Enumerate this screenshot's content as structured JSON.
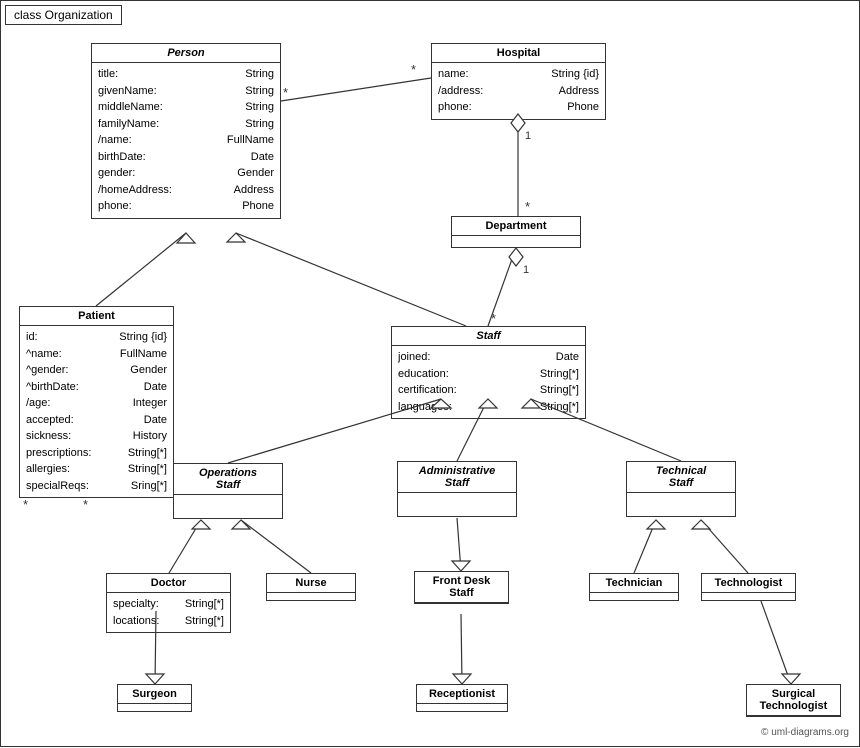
{
  "diagram": {
    "title": "class Organization",
    "watermark": "© uml-diagrams.org",
    "boxes": {
      "person": {
        "title": "Person",
        "italic": true,
        "attributes": [
          {
            "name": "title:",
            "type": "String"
          },
          {
            "name": "givenName:",
            "type": "String"
          },
          {
            "name": "middleName:",
            "type": "String"
          },
          {
            "name": "familyName:",
            "type": "String"
          },
          {
            "name": "/name:",
            "type": "FullName"
          },
          {
            "name": "birthDate:",
            "type": "Date"
          },
          {
            "name": "gender:",
            "type": "Gender"
          },
          {
            "name": "/homeAddress:",
            "type": "Address"
          },
          {
            "name": "phone:",
            "type": "Phone"
          }
        ]
      },
      "hospital": {
        "title": "Hospital",
        "italic": false,
        "attributes": [
          {
            "name": "name:",
            "type": "String {id}"
          },
          {
            "name": "/address:",
            "type": "Address"
          },
          {
            "name": "phone:",
            "type": "Phone"
          }
        ]
      },
      "department": {
        "title": "Department",
        "italic": false,
        "attributes": []
      },
      "staff": {
        "title": "Staff",
        "italic": true,
        "attributes": [
          {
            "name": "joined:",
            "type": "Date"
          },
          {
            "name": "education:",
            "type": "String[*]"
          },
          {
            "name": "certification:",
            "type": "String[*]"
          },
          {
            "name": "languages:",
            "type": "String[*]"
          }
        ]
      },
      "patient": {
        "title": "Patient",
        "italic": false,
        "attributes": [
          {
            "name": "id:",
            "type": "String {id}"
          },
          {
            "name": "^name:",
            "type": "FullName"
          },
          {
            "name": "^gender:",
            "type": "Gender"
          },
          {
            "name": "^birthDate:",
            "type": "Date"
          },
          {
            "name": "/age:",
            "type": "Integer"
          },
          {
            "name": "accepted:",
            "type": "Date"
          },
          {
            "name": "sickness:",
            "type": "History"
          },
          {
            "name": "prescriptions:",
            "type": "String[*]"
          },
          {
            "name": "allergies:",
            "type": "String[*]"
          },
          {
            "name": "specialReqs:",
            "type": "Sring[*]"
          }
        ]
      },
      "operations_staff": {
        "title": "Operations\nStaff",
        "italic": true,
        "attributes": []
      },
      "administrative_staff": {
        "title": "Administrative\nStaff",
        "italic": true,
        "attributes": []
      },
      "technical_staff": {
        "title": "Technical\nStaff",
        "italic": true,
        "attributes": []
      },
      "doctor": {
        "title": "Doctor",
        "italic": false,
        "attributes": [
          {
            "name": "specialty:",
            "type": "String[*]"
          },
          {
            "name": "locations:",
            "type": "String[*]"
          }
        ]
      },
      "nurse": {
        "title": "Nurse",
        "italic": false,
        "attributes": []
      },
      "front_desk_staff": {
        "title": "Front Desk\nStaff",
        "italic": false,
        "attributes": []
      },
      "technician": {
        "title": "Technician",
        "italic": false,
        "attributes": []
      },
      "technologist": {
        "title": "Technologist",
        "italic": false,
        "attributes": []
      },
      "surgeon": {
        "title": "Surgeon",
        "italic": false,
        "attributes": []
      },
      "receptionist": {
        "title": "Receptionist",
        "italic": false,
        "attributes": []
      },
      "surgical_technologist": {
        "title": "Surgical\nTechnologist",
        "italic": false,
        "attributes": []
      }
    }
  }
}
